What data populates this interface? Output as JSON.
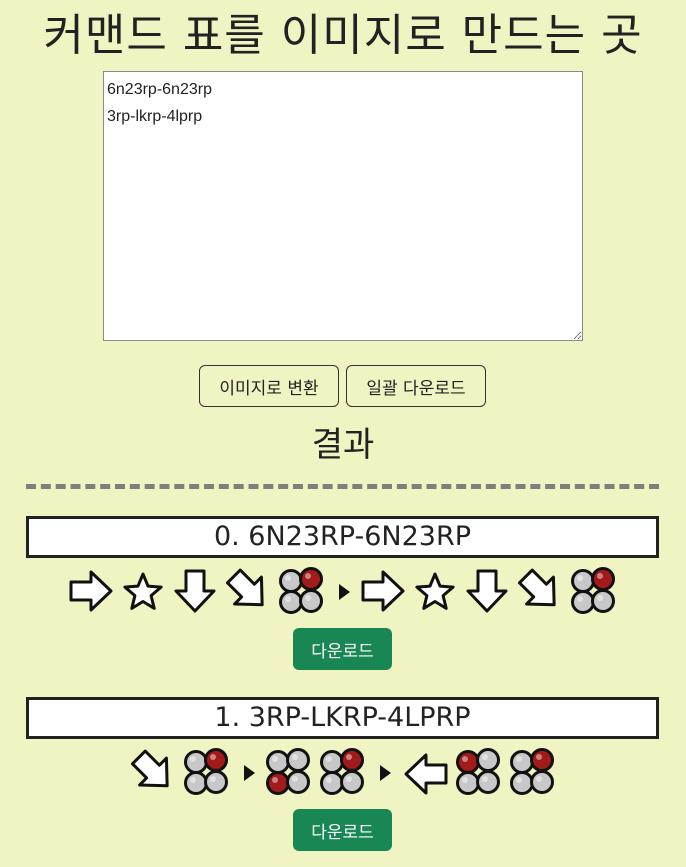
{
  "page": {
    "title": "커맨드 표를 이미지로 만드는 곳"
  },
  "input": {
    "value": "6n23rp-6n23rp\n3rp-lkrp-4lprp"
  },
  "buttons": {
    "convert": "이미지로 변환",
    "bulk_download": "일괄 다운로드"
  },
  "results": {
    "heading": "결과",
    "items": [
      {
        "label": "0. 6N23RP-6N23RP",
        "download": "다운로드",
        "icons": [
          "arrow-right",
          "neutral-star",
          "arrow-down",
          "arrow-down-right",
          "button-rp",
          "separator",
          "arrow-right",
          "neutral-star",
          "arrow-down",
          "arrow-down-right",
          "button-rp"
        ]
      },
      {
        "label": "1. 3RP-LKRP-4LPRP",
        "download": "다운로드",
        "icons": [
          "arrow-down-right",
          "button-rp",
          "separator",
          "button-lk",
          "button-rp",
          "separator",
          "arrow-left",
          "button-lp",
          "button-rp"
        ]
      }
    ]
  },
  "colors": {
    "background": "#f0f3c2",
    "button_pressed": "#a31a1a",
    "button_idle": "#c8c8c8",
    "download_button": "#198754"
  }
}
